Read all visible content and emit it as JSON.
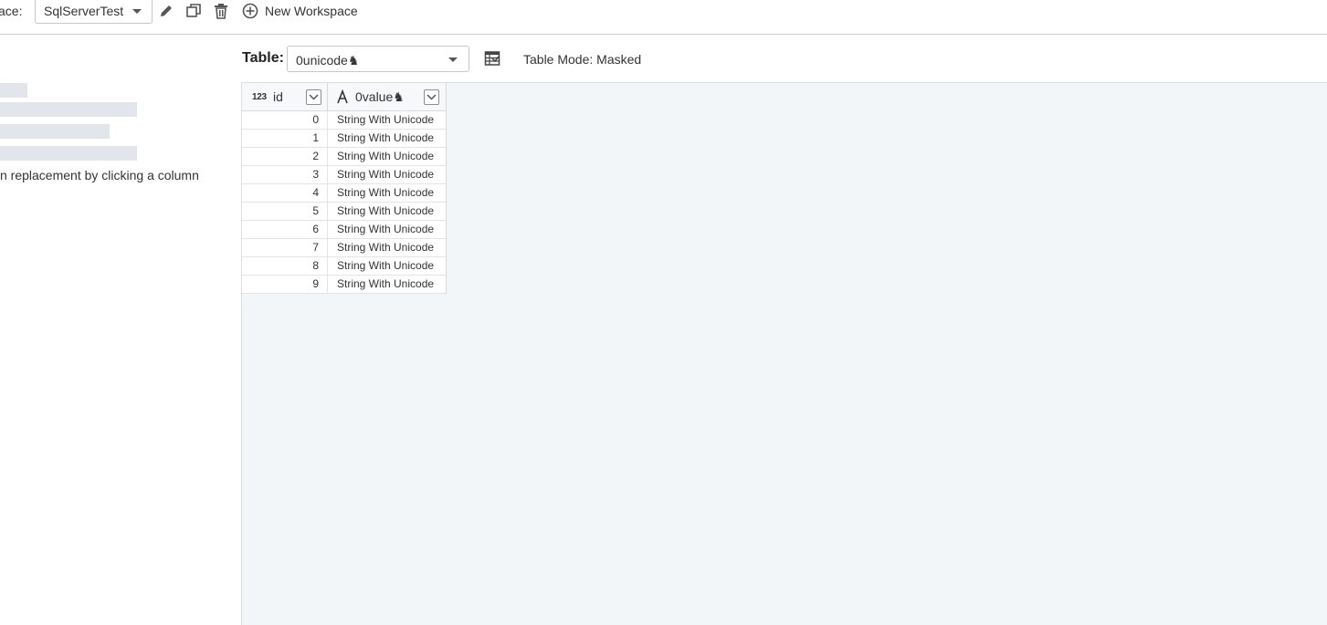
{
  "topbar": {
    "workspace_label": "ace:",
    "workspace_value": "SqlServerTest",
    "new_workspace_label": "New Workspace"
  },
  "left_panel": {
    "hint": "n replacement by clicking a column"
  },
  "table_selector": {
    "label": "Table:",
    "value": "0unicode♞",
    "mode": "Table Mode: Masked"
  },
  "grid": {
    "columns": [
      {
        "name": "id",
        "type_icon": "123"
      },
      {
        "name": "0value♞",
        "type_icon": "string-A-icon"
      }
    ],
    "rows": [
      {
        "id": "0",
        "value": "String With Unicode"
      },
      {
        "id": "1",
        "value": "String With Unicode"
      },
      {
        "id": "2",
        "value": "String With Unicode"
      },
      {
        "id": "3",
        "value": "String With Unicode"
      },
      {
        "id": "4",
        "value": "String With Unicode"
      },
      {
        "id": "5",
        "value": "String With Unicode"
      },
      {
        "id": "6",
        "value": "String With Unicode"
      },
      {
        "id": "7",
        "value": "String With Unicode"
      },
      {
        "id": "8",
        "value": "String With Unicode"
      },
      {
        "id": "9",
        "value": "String With Unicode"
      }
    ]
  },
  "colors": {
    "grid_background": "#f2f6f9",
    "skeleton": "#e2e6ec",
    "border": "#cfcfcf"
  }
}
